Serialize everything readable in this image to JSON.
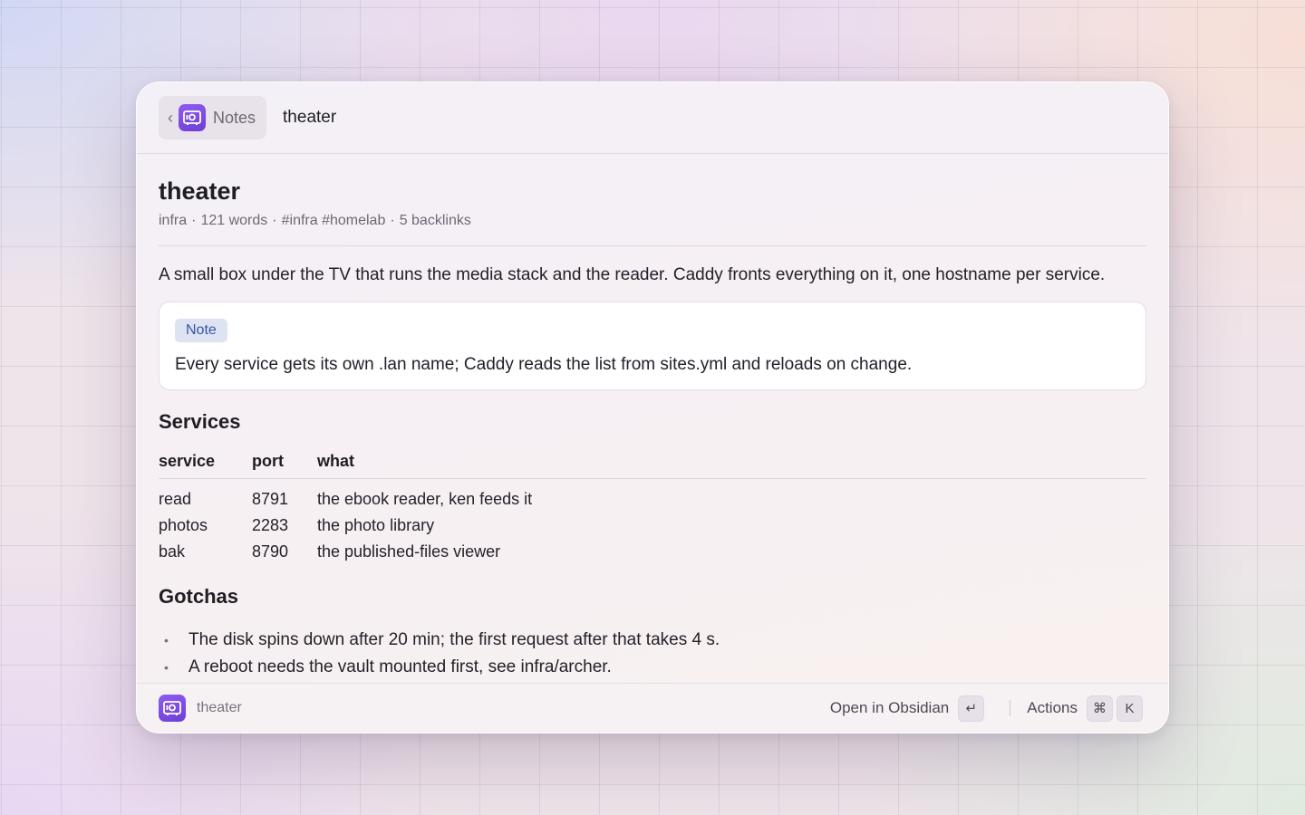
{
  "header": {
    "back_label": "Notes",
    "title": "theater"
  },
  "note": {
    "title": "theater",
    "meta": {
      "folder": "infra",
      "words": "121 words",
      "tags": "#infra #homelab",
      "backlinks": "5 backlinks"
    },
    "intro": "A small box under the TV that runs the media stack and the reader. Caddy fronts everything on it, one hostname per service.",
    "callout": {
      "badge": "Note",
      "text": "Every service gets its own .lan name; Caddy reads the list from sites.yml and reloads on change."
    },
    "services": {
      "heading": "Services",
      "columns": [
        "service",
        "port",
        "what"
      ],
      "rows": [
        [
          "read",
          "8791",
          "the ebook reader, ken feeds it"
        ],
        [
          "photos",
          "2283",
          "the photo library"
        ],
        [
          "bak",
          "8790",
          "the published-files viewer"
        ]
      ]
    },
    "gotchas": {
      "heading": "Gotchas",
      "items": [
        "The disk spins down after 20 min; the first request after that takes 4 s.",
        "A reboot needs the vault mounted first, see infra/archer."
      ]
    }
  },
  "footer": {
    "note_name": "theater",
    "open_label": "Open in Obsidian",
    "open_key": "↵",
    "actions_label": "Actions",
    "actions_keys": [
      "⌘",
      "K"
    ]
  },
  "colors": {
    "accent": "#7b4ce6",
    "callout_badge_bg": "#dde3f2",
    "callout_badge_text": "#3556a3"
  },
  "icons": {
    "app": "vault-icon",
    "back": "chevron-left-icon"
  }
}
